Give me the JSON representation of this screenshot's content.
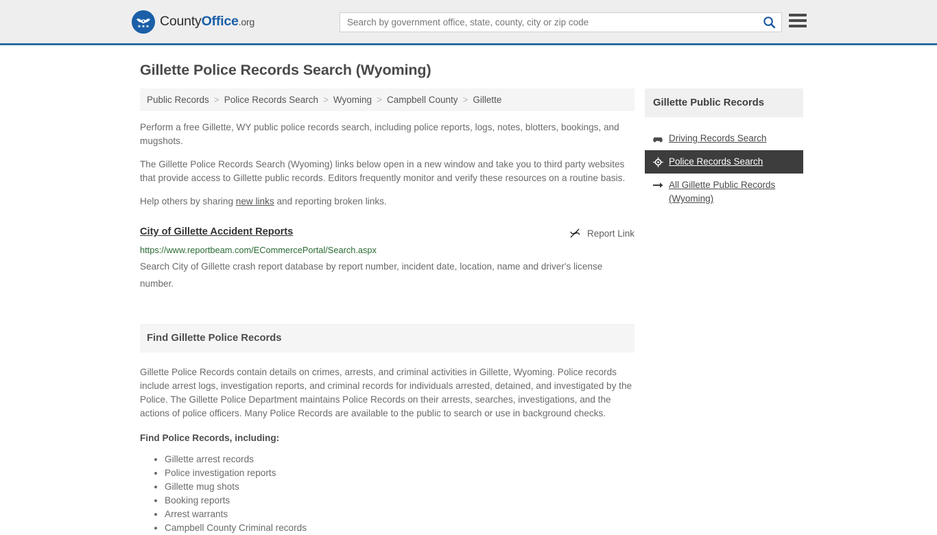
{
  "header": {
    "logo": {
      "text_part1": "County",
      "text_part2": "Office",
      "text_tld": ".org",
      "icon": "eagle-stars-seal-icon",
      "brand_color": "#1a5fa8"
    },
    "search": {
      "placeholder": "Search by government office, state, county, city or zip code",
      "value": "",
      "button_icon": "search-icon"
    },
    "menu_icon": "hamburger-menu-icon",
    "accent_border_color": "#2b6da4"
  },
  "page": {
    "title": "Gillette Police Records Search (Wyoming)"
  },
  "breadcrumb": {
    "separator": ">",
    "items": [
      {
        "label": "Public Records"
      },
      {
        "label": "Police Records Search"
      },
      {
        "label": "Wyoming"
      },
      {
        "label": "Campbell County"
      },
      {
        "label": "Gillette"
      }
    ]
  },
  "intro": {
    "p1": "Perform a free Gillette, WY public police records search, including police reports, logs, notes, blotters, bookings, and mugshots.",
    "p2": "The Gillette Police Records Search (Wyoming) links below open in a new window and take you to third party websites that provide access to Gillette public records. Editors frequently monitor and verify these resources on a routine basis.",
    "p3_prefix": "Help others by sharing ",
    "p3_link": "new links",
    "p3_suffix": " and reporting broken links."
  },
  "result": {
    "title": "City of Gillette Accident Reports",
    "url": "https://www.reportbeam.com/ECommercePortal/Search.aspx",
    "description": "Search City of Gillette crash report database by report number, incident date, location, name and driver's license number.",
    "report_label": "Report Link",
    "report_icon": "broken-link-icon",
    "url_color": "#2a6b33"
  },
  "find_section": {
    "heading": "Find Gillette Police Records",
    "body": "Gillette Police Records contain details on crimes, arrests, and criminal activities in Gillette, Wyoming. Police records include arrest logs, investigation reports, and criminal records for individuals arrested, detained, and investigated by the Police. The Gillette Police Department maintains Police Records on their arrests, searches, investigations, and the actions of police officers. Many Police Records are available to the public to search or use in background checks.",
    "subheading": "Find Police Records, including:",
    "items": [
      "Gillette arrest records",
      "Police investigation reports",
      "Gillette mug shots",
      "Booking reports",
      "Arrest warrants",
      "Campbell County Criminal records"
    ]
  },
  "sidebar": {
    "heading": "Gillette Public Records",
    "items": [
      {
        "label": "Driving Records Search",
        "icon": "car-icon",
        "active": false
      },
      {
        "label": "Police Records Search",
        "icon": "police-badge-icon",
        "active": true
      },
      {
        "label": "All Gillette Public Records (Wyoming)",
        "icon": "arrow-right-icon",
        "active": false
      }
    ],
    "active_bg_color": "#3d3d3d"
  }
}
